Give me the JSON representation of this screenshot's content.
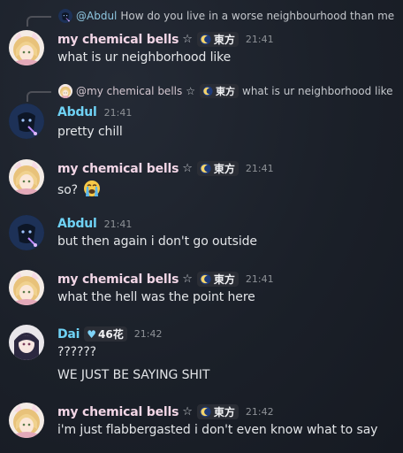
{
  "users": {
    "bells": {
      "name": "my chemical bells",
      "star": "☆",
      "tag": "東方"
    },
    "abdul": {
      "name": "Abdul"
    },
    "dai": {
      "name": "Dai",
      "tag": "46花"
    }
  },
  "messages": [
    {
      "reply": {
        "name": "@Abdul",
        "text": "How do you live in a worse neighbourhood than me"
      },
      "time": "21:41",
      "lines": [
        "what is ur neighborhood like"
      ]
    },
    {
      "reply": {
        "name": "@my chemical bells",
        "star": "☆",
        "tag": "東方",
        "text": "what is ur neighborhood like"
      },
      "time": "21:41",
      "lines": [
        "pretty chill"
      ]
    },
    {
      "time": "21:41",
      "lines": [
        "so?"
      ],
      "emoji": "loudly-crying-face"
    },
    {
      "time": "21:41",
      "lines": [
        "but then again i don't go outside"
      ]
    },
    {
      "time": "21:41",
      "lines": [
        "what the hell was the point here"
      ]
    },
    {
      "time": "21:42",
      "lines": [
        "??????",
        "WE JUST BE SAYING SHIT"
      ]
    },
    {
      "time": "21:42",
      "lines": [
        "i'm just flabbergasted i don't even know what to say"
      ]
    }
  ],
  "colors": {
    "bells_name": "#f2d6e6",
    "abdul_name": "#6fd2f5",
    "dai_name": "#6fd2f5",
    "background": "#1b2029"
  }
}
